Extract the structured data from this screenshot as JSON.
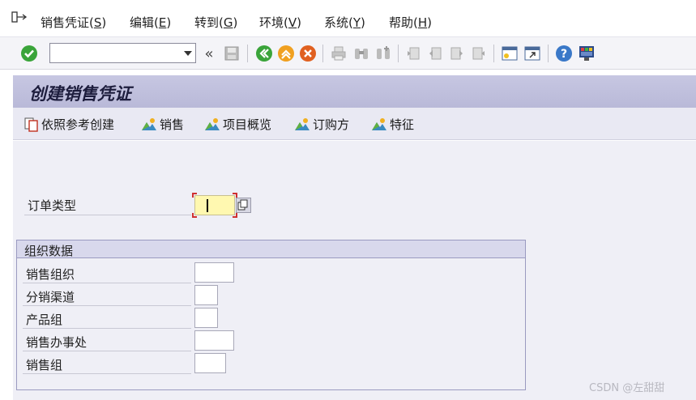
{
  "menu": {
    "items": [
      {
        "text": "销售凭证(",
        "key": "S",
        "tail": ")"
      },
      {
        "text": "编辑(",
        "key": "E",
        "tail": ")"
      },
      {
        "text": "转到(",
        "key": "G",
        "tail": ")"
      },
      {
        "text": "环境(",
        "key": "V",
        "tail": ")"
      },
      {
        "text": "系统(",
        "key": "Y",
        "tail": ")"
      },
      {
        "text": "帮助(",
        "key": "H",
        "tail": ")"
      }
    ]
  },
  "toolbar": {
    "command_value": "",
    "icons": [
      "enter-check-icon",
      "command-field",
      "collapse-icon",
      "save-icon",
      "back-icon",
      "exit-icon",
      "cancel-icon",
      "print-icon",
      "find-icon",
      "find-next-icon",
      "first-page-icon",
      "prev-page-icon",
      "next-page-icon",
      "last-page-icon",
      "new-session-icon",
      "shortcut-icon",
      "help-icon",
      "layout-menu-icon"
    ]
  },
  "title": "创建销售凭证",
  "app_toolbar": {
    "create_with_ref": "依照参考创建",
    "sales": "销售",
    "item_overview": "项目概览",
    "ordering_party": "订购方",
    "characteristics": "特征"
  },
  "order_type": {
    "label": "订单类型",
    "value": ""
  },
  "org_data": {
    "title": "组织数据",
    "fields": [
      {
        "label": "销售组织",
        "value": ""
      },
      {
        "label": "分销渠道",
        "value": ""
      },
      {
        "label": "产品组",
        "value": ""
      },
      {
        "label": "销售办事处",
        "value": ""
      },
      {
        "label": "销售组",
        "value": ""
      }
    ]
  },
  "watermark": "CSDN @左甜甜",
  "colors": {
    "title_band": "#bcbcda",
    "content_bg": "#efeff6",
    "required_field": "#fff8b0",
    "enter_green": "#3aa43a"
  }
}
